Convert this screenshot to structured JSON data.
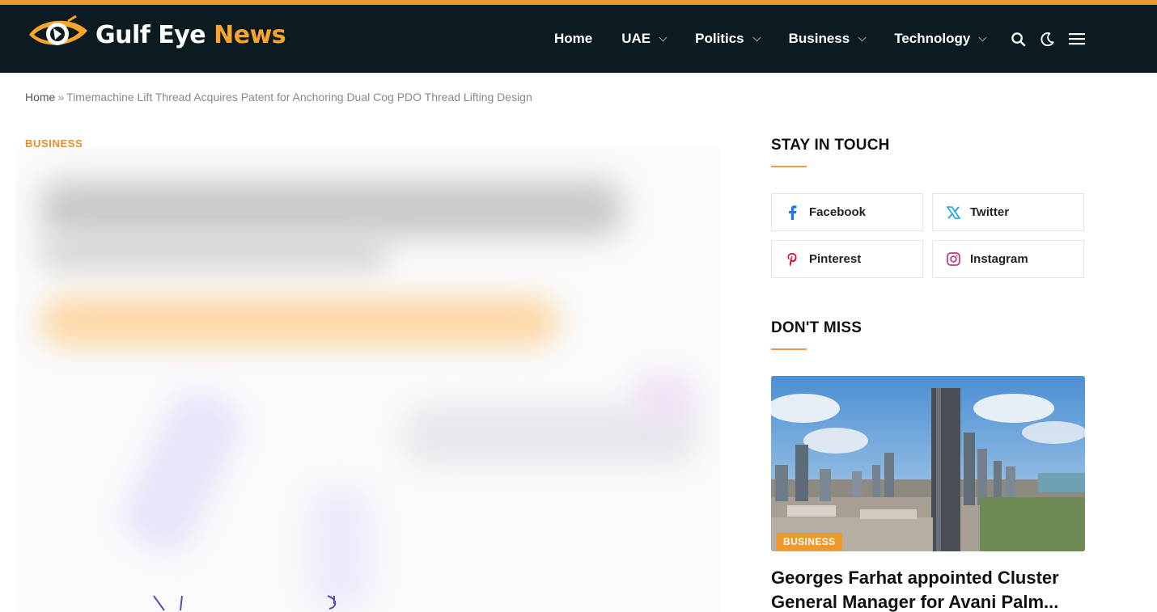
{
  "site": {
    "logo_word1": "Gulf Eye",
    "logo_word2": "News"
  },
  "nav": {
    "items": [
      {
        "label": "Home",
        "has_dropdown": false
      },
      {
        "label": "UAE",
        "has_dropdown": true
      },
      {
        "label": "Politics",
        "has_dropdown": true
      },
      {
        "label": "Business",
        "has_dropdown": true
      },
      {
        "label": "Technology",
        "has_dropdown": true
      }
    ],
    "icons": [
      "search-icon",
      "dark-mode-icon",
      "menu-icon"
    ]
  },
  "breadcrumb": {
    "home": "Home",
    "separator": "»",
    "current": "Timemachine Lift Thread Acquires Patent for Anchoring Dual Cog PDO Thread Lifting Design"
  },
  "article": {
    "category": "BUSINESS"
  },
  "sidebar": {
    "stay_in_touch": {
      "title": "STAY IN TOUCH",
      "links": [
        {
          "label": "Facebook",
          "icon": "facebook-icon",
          "color": "#1877f2"
        },
        {
          "label": "Twitter",
          "icon": "twitter-x-icon",
          "color": "#1da1f2"
        },
        {
          "label": "Pinterest",
          "icon": "pinterest-icon",
          "color": "#e60023"
        },
        {
          "label": "Instagram",
          "icon": "instagram-icon",
          "color": "#c13584"
        }
      ]
    },
    "dont_miss": {
      "title": "DON'T MISS",
      "card": {
        "badge": "BUSINESS",
        "headline": "Georges Farhat appointed Cluster General Manager for Avani Palm..."
      }
    }
  },
  "colors": {
    "accent": "#f0982a",
    "header_bg": "#0b1b20"
  }
}
